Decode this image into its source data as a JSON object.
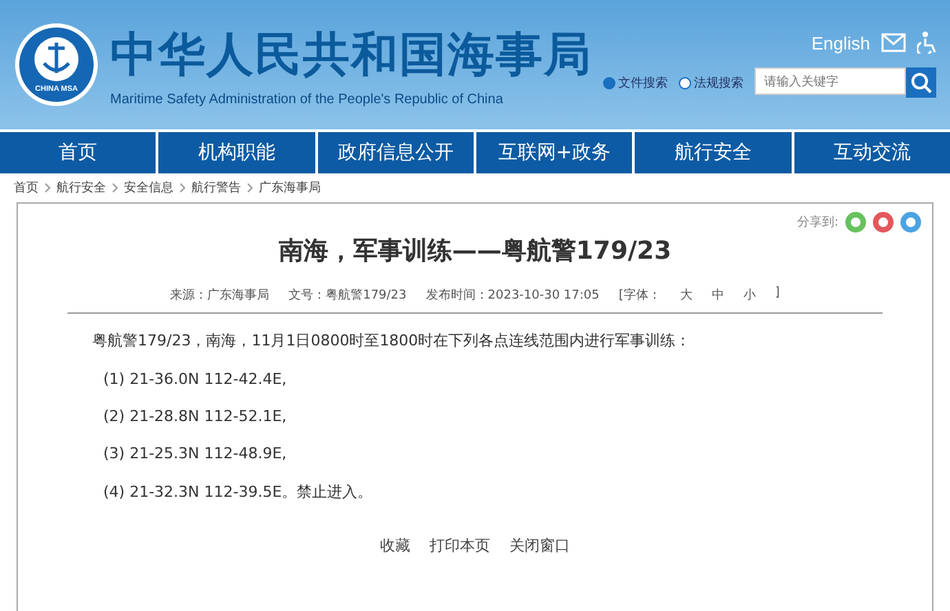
{
  "header": {
    "title": "中华人民共和国海事局",
    "subtitle": "Maritime Safety Administration of the People's Republic of China",
    "logo_text": "CHINA MSA",
    "language_link": "English",
    "search_scopes": [
      {
        "label": "文件搜索",
        "selected": true
      },
      {
        "label": "法规搜索",
        "selected": false
      }
    ],
    "search": {
      "placeholder": "请输入关键字"
    }
  },
  "nav": [
    {
      "label": "首页"
    },
    {
      "label": "机构职能"
    },
    {
      "label": "政府信息公开"
    },
    {
      "label": "互联网+政务"
    },
    {
      "label": "航行安全"
    },
    {
      "label": "互动交流"
    }
  ],
  "breadcrumb": [
    "首页",
    "航行安全",
    "安全信息",
    "航行警告",
    "广东海事局"
  ],
  "article": {
    "share_label": "分享到:",
    "title": "南海，军事训练——粤航警179/23",
    "meta": [
      "来源：广东海事局",
      "文号：粤航警179/23",
      "发布时间：2023-10-30 17:05"
    ],
    "font_size": {
      "label": "[字体：",
      "options": [
        "大",
        "中",
        "小"
      ],
      "end": "]"
    },
    "paragraphs": [
      "粤航警179/23，南海，11月1日0800时至1800时在下列各点连线范围内进行军事训练：",
      "(1) 21-36.0N 112-42.4E,",
      "(2) 21-28.8N 112-52.1E,",
      "(3) 21-25.3N 112-48.9E,",
      "(4) 21-32.3N 112-39.5E。禁止进入。"
    ],
    "actions": [
      "收藏",
      "打印本页",
      "关闭窗口"
    ]
  }
}
